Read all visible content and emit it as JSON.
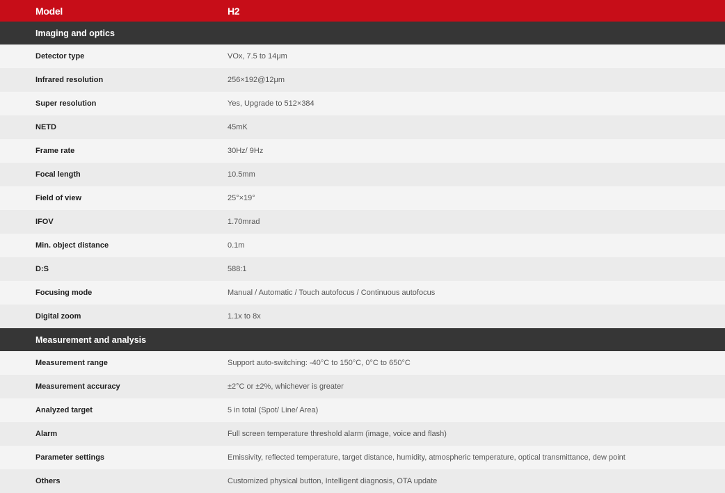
{
  "header": {
    "label": "Model",
    "value": "H2"
  },
  "sections": [
    {
      "title": "Imaging and optics",
      "rows": [
        {
          "label": "Detector type",
          "value": "VOx, 7.5 to 14μm"
        },
        {
          "label": "Infrared resolution",
          "value": "256×192@12μm"
        },
        {
          "label": "Super resolution",
          "value": "Yes, Upgrade to 512×384"
        },
        {
          "label": "NETD",
          "value": "45mK"
        },
        {
          "label": "Frame rate",
          "value": "30Hz/ 9Hz"
        },
        {
          "label": "Focal length",
          "value": "10.5mm"
        },
        {
          "label": "Field of view",
          "value": "25°×19°"
        },
        {
          "label": "IFOV",
          "value": "1.70mrad"
        },
        {
          "label": "Min. object distance",
          "value": "0.1m"
        },
        {
          "label": "D:S",
          "value": "588:1"
        },
        {
          "label": "Focusing mode",
          "value": "Manual / Automatic / Touch autofocus / Continuous autofocus"
        },
        {
          "label": "Digital zoom",
          "value": "1.1x to 8x"
        }
      ]
    },
    {
      "title": "Measurement and analysis",
      "rows": [
        {
          "label": "Measurement range",
          "value": "Support auto-switching: -40°C to 150°C, 0°C to 650°C"
        },
        {
          "label": "Measurement accuracy",
          "value": "±2°C or ±2%, whichever is greater"
        },
        {
          "label": "Analyzed target",
          "value": "5 in total (Spot/ Line/ Area)"
        },
        {
          "label": "Alarm",
          "value": "Full screen temperature threshold alarm (image, voice and flash)"
        },
        {
          "label": "Parameter settings",
          "value": "Emissivity, reflected temperature, target distance, humidity, atmospheric temperature, optical transmittance, dew point"
        },
        {
          "label": "Others",
          "value": "Customized physical button, Intelligent diagnosis, OTA update"
        }
      ]
    }
  ],
  "colors": {
    "header_bg": "#c70d18",
    "section_bg": "#363636",
    "row_light": "#f4f4f4",
    "row_dark": "#ebebeb"
  }
}
